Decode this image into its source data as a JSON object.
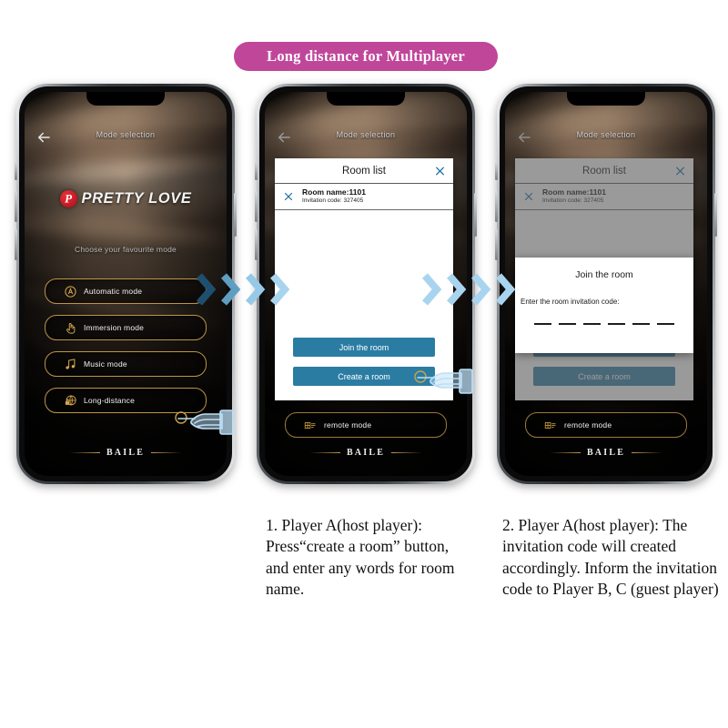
{
  "banner": {
    "title": "Long distance for Multiplayer"
  },
  "app": {
    "header": {
      "title": "Mode selection",
      "back_icon": "back-arrow-icon"
    },
    "brand": {
      "badge_letter": "P",
      "wordmark": "PRETTY LOVE"
    },
    "prompt": "Choose your favourite mode",
    "footer_brand": "BAILE",
    "modes": [
      {
        "label": "Automatic mode",
        "icon": "automatic-circle-a-icon"
      },
      {
        "label": "Immersion mode",
        "icon": "pointing-hand-icon"
      },
      {
        "label": "Music mode",
        "icon": "music-note-icon"
      },
      {
        "label": "Long-distance",
        "icon": "globe-lock-icon"
      }
    ],
    "remote_mode": {
      "label": "remote mode",
      "icon": "remote-mode-icon"
    }
  },
  "room_list_dialog": {
    "title": "Room list",
    "close_icon": "close-x-icon",
    "row_close_icon": "close-x-icon",
    "rows": [
      {
        "room_name": "Room name:1101",
        "invitation_code": "Invitation code:  327405"
      }
    ],
    "buttons": [
      {
        "label": "Join the room"
      },
      {
        "label": "Create a room"
      }
    ]
  },
  "join_dialog": {
    "title": "Join the room",
    "prompt": "Enter the room invitation code:",
    "slots": 6
  },
  "captions": {
    "step1": "1. Player A(host player): Press“create a room” button, and enter any words for room name.",
    "step2": "2. Player A(host player): The invitation code will created accordingly. Inform the invitation code to Player B, C (guest player)"
  },
  "colors": {
    "banner_pink": "#c0469a",
    "button_teal": "#2b7ca3",
    "mode_gold": "#bd9445",
    "chevron_blue": "#a9d4ef",
    "hand_blue": "#a9d4ef"
  }
}
